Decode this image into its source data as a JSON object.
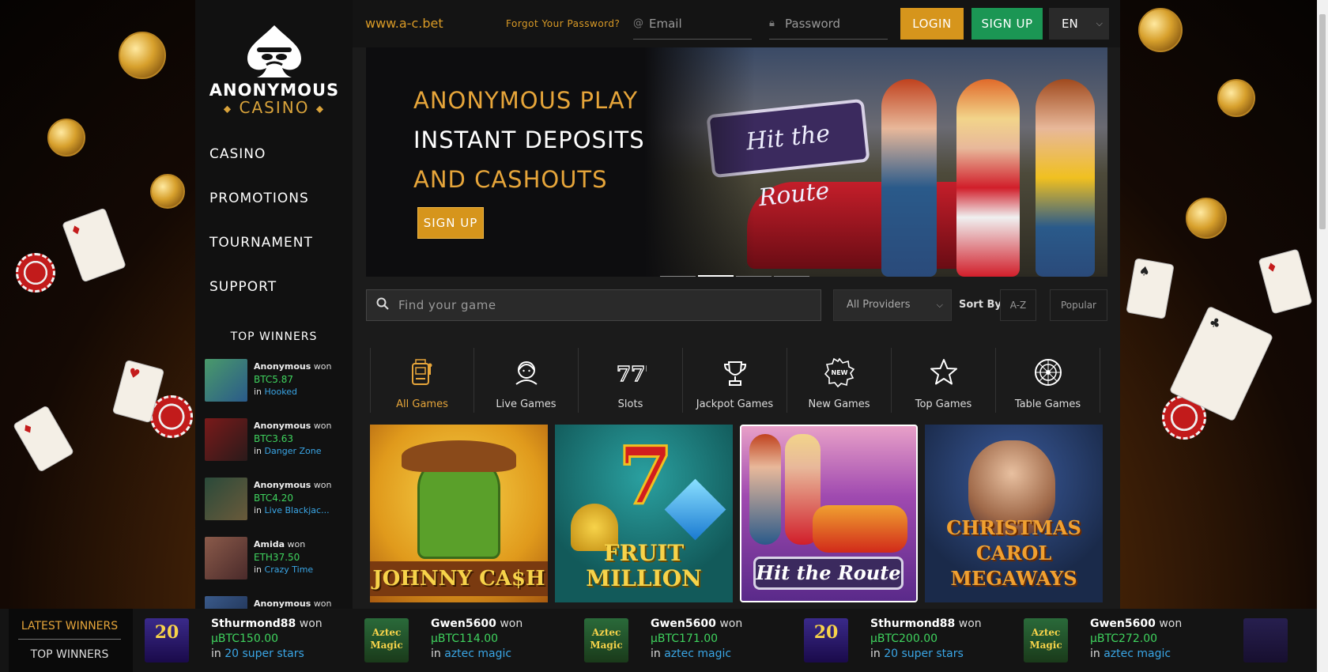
{
  "header": {
    "site_url": "www.a-c.bet",
    "forgot_password": "Forgot Your Password?",
    "email_placeholder": "Email",
    "password_placeholder": "Password",
    "login_label": "LOGIN",
    "signup_label": "SIGN UP",
    "language": "EN"
  },
  "logo": {
    "line1": "ANONYMOUS",
    "line2": "CASINO"
  },
  "sidebar": {
    "nav": [
      "CASINO",
      "PROMOTIONS",
      "TOURNAMENT",
      "SUPPORT"
    ],
    "top_winners_title": "TOP WINNERS",
    "winners": [
      {
        "name": "Anonymous",
        "won": "won",
        "amount": "BTC5.87",
        "in": "in",
        "game": "Hooked"
      },
      {
        "name": "Anonymous",
        "won": "won",
        "amount": "BTC3.63",
        "in": "in",
        "game": "Danger Zone"
      },
      {
        "name": "Anonymous",
        "won": "won",
        "amount": "BTC4.20",
        "in": "in",
        "game": "Live Blackjac..."
      },
      {
        "name": "Amida",
        "won": "won",
        "amount": "ETH37.50",
        "in": "in",
        "game": "Crazy Time"
      },
      {
        "name": "Anonymous",
        "won": "won",
        "amount": "",
        "in": "",
        "game": ""
      }
    ]
  },
  "banner": {
    "line1": "ANONYMOUS PLAY",
    "line2": "INSTANT DEPOSITS",
    "line3": "AND CASHOUTS",
    "signup_label": "SIGN UP",
    "art_title": "Hit the Route",
    "slides": 4,
    "active_slide": 2
  },
  "search": {
    "placeholder": "Find your game",
    "providers_label": "All Providers",
    "sort_by_label": "Sort By:",
    "sort_az": "A-Z",
    "sort_popular": "Popular"
  },
  "categories": [
    {
      "label": "All Games",
      "icon": "slot-machine-icon",
      "active": true
    },
    {
      "label": "Live Games",
      "icon": "live-dealer-icon",
      "active": false
    },
    {
      "label": "Slots",
      "icon": "777-icon",
      "active": false
    },
    {
      "label": "Jackpot Games",
      "icon": "trophy-icon",
      "active": false
    },
    {
      "label": "New Games",
      "icon": "new-badge-icon",
      "active": false
    },
    {
      "label": "Top Games",
      "icon": "star-icon",
      "active": false
    },
    {
      "label": "Table Games",
      "icon": "roulette-icon",
      "active": false
    }
  ],
  "games": [
    {
      "title": "JOHNNY CA$H",
      "bg": "#e8a526"
    },
    {
      "title": "FRUIT MILLION",
      "bg": "#1c6e6a"
    },
    {
      "title": "Hit the Route",
      "bg": "#8a4a9a"
    },
    {
      "title": "CHRISTMAS CAROL MEGAWAYS",
      "bg": "#1d2f5a"
    }
  ],
  "footer": {
    "tab_latest": "LATEST WINNERS",
    "tab_top": "TOP WINNERS",
    "winners": [
      {
        "name": "Sthurmond88",
        "won": "won",
        "amount": "µBTC150.00",
        "in": "in",
        "game": "20 super stars",
        "thumb": "20"
      },
      {
        "name": "Gwen5600",
        "won": "won",
        "amount": "µBTC114.00",
        "in": "in",
        "game": "aztec magic",
        "thumb": "Aztec Magic"
      },
      {
        "name": "Gwen5600",
        "won": "won",
        "amount": "µBTC171.00",
        "in": "in",
        "game": "aztec magic",
        "thumb": "Aztec Magic"
      },
      {
        "name": "Sthurmond88",
        "won": "won",
        "amount": "µBTC200.00",
        "in": "in",
        "game": "20 super stars",
        "thumb": "20"
      },
      {
        "name": "Gwen5600",
        "won": "won",
        "amount": "µBTC272.00",
        "in": "in",
        "game": "aztec magic",
        "thumb": "Aztec Magic"
      }
    ]
  },
  "colors": {
    "accent_gold": "#d6951c",
    "signup_green": "#1b9654",
    "amount_green": "#3fd35e",
    "link_blue": "#3aa6e6"
  }
}
